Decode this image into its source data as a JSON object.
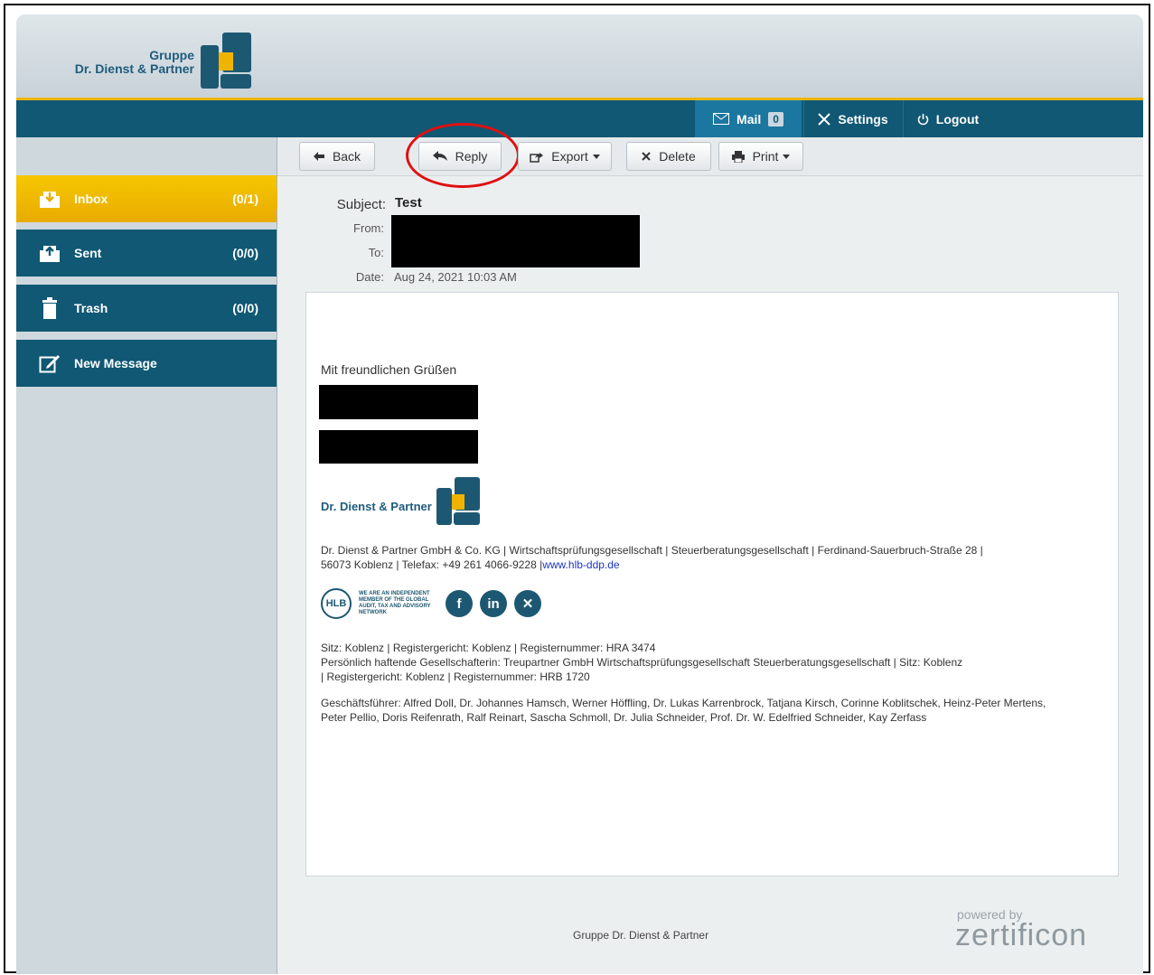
{
  "brand": {
    "line1": "Gruppe",
    "line2": "Dr. Dienst & Partner"
  },
  "nav": {
    "mail_label": "Mail",
    "mail_count": "0",
    "settings_label": "Settings",
    "logout_label": "Logout"
  },
  "sidebar": {
    "items": [
      {
        "label": "Inbox",
        "count": "(0/1)"
      },
      {
        "label": "Sent",
        "count": "(0/0)"
      },
      {
        "label": "Trash",
        "count": "(0/0)"
      },
      {
        "label": "New Message",
        "count": ""
      }
    ]
  },
  "toolbar": {
    "back": "Back",
    "reply": "Reply",
    "export": "Export",
    "delete": "Delete",
    "print": "Print"
  },
  "header": {
    "subject_label": "Subject:",
    "subject_value": "Test",
    "from_label": "From:",
    "to_label": "To:",
    "date_label": "Date:",
    "date_value": "Aug 24, 2021 10:03 AM"
  },
  "message": {
    "greeting": "Mit freundlichen Grüßen",
    "sig_logo_text": "Dr. Dienst & Partner",
    "company_line1": "Dr. Dienst & Partner GmbH & Co. KG | Wirtschaftsprüfungsgesellschaft | Steuerberatungsgesellschaft | Ferdinand-Sauerbruch-Straße 28 |",
    "company_line2": "56073 Koblenz | Telefax: +49 261 4066-9228 |",
    "website": "www.hlb-ddp.de",
    "hlb_badge": "HLB",
    "hlb_text": "WE ARE AN INDEPENDENT MEMBER OF THE GLOBAL AUDIT, TAX AND ADVISORY NETWORK",
    "reg_line1": "Sitz: Koblenz | Registergericht: Koblenz | Registernummer: HRA 3474",
    "reg_line2": "Persönlich haftende Gesellschafterin: Treupartner GmbH Wirtschaftsprüfungsgesellschaft Steuerberatungsgesellschaft | Sitz: Koblenz",
    "reg_line3": "| Registergericht: Koblenz | Registernummer: HRB 1720",
    "gf_line1": "Geschäftsführer: Alfred Doll, Dr. Johannes Hamsch, Werner Höffling, Dr. Lukas Karrenbrock, Tatjana Kirsch, Corinne Koblitschek, Heinz-Peter Mertens,",
    "gf_line2": "Peter Pellio, Doris Reifenrath, Ralf Reinart, Sascha Schmoll, Dr. Julia Schneider, Prof. Dr. W. Edelfried Schneider, Kay Zerfass"
  },
  "footer": {
    "text": "Gruppe Dr. Dienst & Partner",
    "powered_by": "powered by",
    "vendor": "zertificon"
  },
  "colors": {
    "nav_bg": "#105874",
    "accent": "#f0b400",
    "mail_active": "#1b77a0",
    "annotation_circle": "#e01010"
  }
}
